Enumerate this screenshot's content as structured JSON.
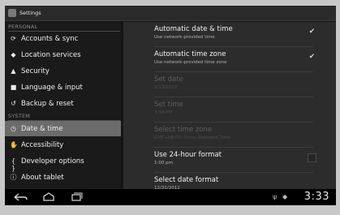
{
  "app": {
    "title": "Settings"
  },
  "sidebar": {
    "headers": {
      "personal": "PERSONAL",
      "system": "SYSTEM"
    },
    "items": [
      {
        "label": "Accounts & sync",
        "icon": "sync-icon"
      },
      {
        "label": "Location services",
        "icon": "location-icon"
      },
      {
        "label": "Security",
        "icon": "lock-icon"
      },
      {
        "label": "Language & input",
        "icon": "keyboard-icon"
      },
      {
        "label": "Backup & reset",
        "icon": "backup-icon"
      },
      {
        "label": "Date & time",
        "icon": "clock-icon",
        "selected": true
      },
      {
        "label": "Accessibility",
        "icon": "hand-icon"
      },
      {
        "label": "Developer options",
        "icon": "braces-icon"
      },
      {
        "label": "About tablet",
        "icon": "info-icon"
      }
    ]
  },
  "settings": [
    {
      "title": "Automatic date & time",
      "subtitle": "Use network-provided time",
      "checked": true,
      "enabled": true
    },
    {
      "title": "Automatic time zone",
      "subtitle": "Use network-provided time zone",
      "checked": true,
      "enabled": true
    },
    {
      "title": "Set date",
      "subtitle": "2/13/2012",
      "enabled": false
    },
    {
      "title": "Set time",
      "subtitle": "3:33 PM",
      "enabled": false
    },
    {
      "title": "Select time zone",
      "subtitle": "GMT+08:00, China Standard Time",
      "enabled": false
    },
    {
      "title": "Use 24-hour format",
      "subtitle": "1:00 pm",
      "checked": false,
      "enabled": true
    },
    {
      "title": "Select date format",
      "subtitle": "12/31/2012",
      "enabled": true
    }
  ],
  "systembar": {
    "clock": "3:33"
  }
}
